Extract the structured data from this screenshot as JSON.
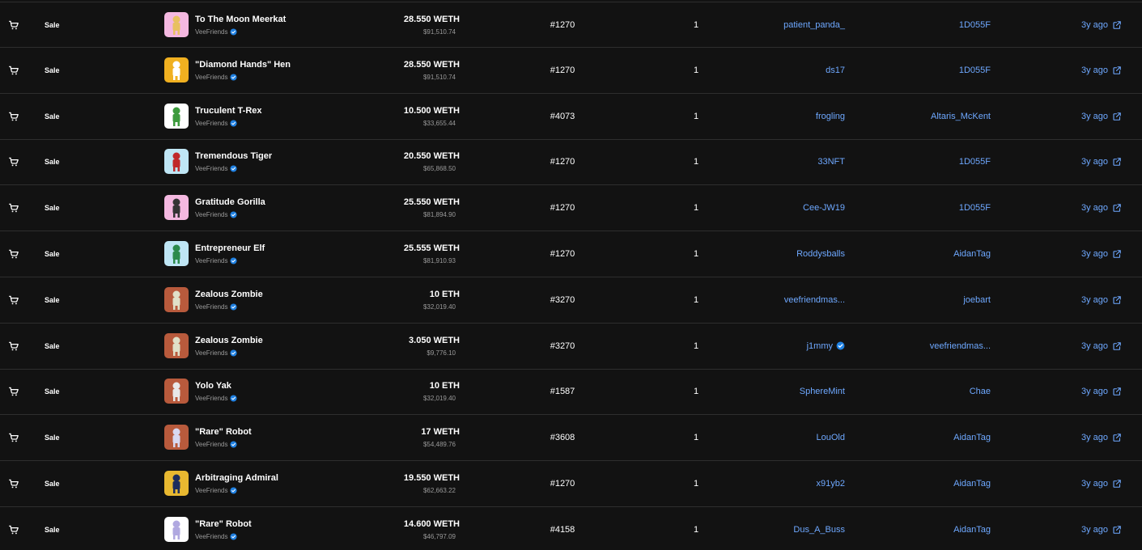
{
  "table": {
    "rows": [
      {
        "event": "Sale",
        "item": "To The Moon Meerkat",
        "collection": "VeeFriends",
        "price": "28.550 WETH",
        "usd": "$91,510.74",
        "rarity": "#1270",
        "quantity": "1",
        "from": "patient_panda_",
        "to": "1D055F",
        "time": "3y ago",
        "thumb_bg": "#f4b8e0",
        "thumb_figure": "#e8c060"
      },
      {
        "event": "Sale",
        "item": "\"Diamond Hands\" Hen",
        "collection": "VeeFriends",
        "price": "28.550 WETH",
        "usd": "$91,510.74",
        "rarity": "#1270",
        "quantity": "1",
        "from": "ds17",
        "to": "1D055F",
        "time": "3y ago",
        "thumb_bg": "#f0b020",
        "thumb_figure": "#ffffff"
      },
      {
        "event": "Sale",
        "item": "Truculent T-Rex",
        "collection": "VeeFriends",
        "price": "10.500 WETH",
        "usd": "$33,655.44",
        "rarity": "#4073",
        "quantity": "1",
        "from": "frogling",
        "to": "Altaris_McKent",
        "time": "3y ago",
        "thumb_bg": "#ffffff",
        "thumb_figure": "#3c9a3c"
      },
      {
        "event": "Sale",
        "item": "Tremendous Tiger",
        "collection": "VeeFriends",
        "price": "20.550 WETH",
        "usd": "$65,868.50",
        "rarity": "#1270",
        "quantity": "1",
        "from": "33NFT",
        "to": "1D055F",
        "time": "3y ago",
        "thumb_bg": "#bfe6f5",
        "thumb_figure": "#c0282a"
      },
      {
        "event": "Sale",
        "item": "Gratitude Gorilla",
        "collection": "VeeFriends",
        "price": "25.550 WETH",
        "usd": "$81,894.90",
        "rarity": "#1270",
        "quantity": "1",
        "from": "Cee-JW19",
        "to": "1D055F",
        "time": "3y ago",
        "thumb_bg": "#f4b8e0",
        "thumb_figure": "#333333"
      },
      {
        "event": "Sale",
        "item": "Entrepreneur Elf",
        "collection": "VeeFriends",
        "price": "25.555 WETH",
        "usd": "$81,910.93",
        "rarity": "#1270",
        "quantity": "1",
        "from": "Roddysballs",
        "to": "AidanTag",
        "time": "3y ago",
        "thumb_bg": "#bfe6f5",
        "thumb_figure": "#2c8a4c"
      },
      {
        "event": "Sale",
        "item": "Zealous Zombie",
        "collection": "VeeFriends",
        "price": "10 ETH",
        "usd": "$32,019.40",
        "rarity": "#3270",
        "quantity": "1",
        "from": "veefriendmas...",
        "to": "joebart",
        "time": "3y ago",
        "thumb_bg": "#b85a3c",
        "thumb_figure": "#e0e0c8"
      },
      {
        "event": "Sale",
        "item": "Zealous Zombie",
        "collection": "VeeFriends",
        "price": "3.050 WETH",
        "usd": "$9,776.10",
        "rarity": "#3270",
        "quantity": "1",
        "from": "j1mmy",
        "from_verified": true,
        "to": "veefriendmas...",
        "time": "3y ago",
        "thumb_bg": "#b85a3c",
        "thumb_figure": "#e0e0c8"
      },
      {
        "event": "Sale",
        "item": "Yolo Yak",
        "collection": "VeeFriends",
        "price": "10 ETH",
        "usd": "$32,019.40",
        "rarity": "#1587",
        "quantity": "1",
        "from": "SphereMint",
        "to": "Chae",
        "time": "3y ago",
        "thumb_bg": "#b85a3c",
        "thumb_figure": "#e8e8e8"
      },
      {
        "event": "Sale",
        "item": "\"Rare\" Robot",
        "collection": "VeeFriends",
        "price": "17 WETH",
        "usd": "$54,489.76",
        "rarity": "#3608",
        "quantity": "1",
        "from": "LouOld",
        "to": "AidanTag",
        "time": "3y ago",
        "thumb_bg": "#b85a3c",
        "thumb_figure": "#d8d8f0"
      },
      {
        "event": "Sale",
        "item": "Arbitraging Admiral",
        "collection": "VeeFriends",
        "price": "19.550 WETH",
        "usd": "$62,663.22",
        "rarity": "#1270",
        "quantity": "1",
        "from": "x91yb2",
        "to": "AidanTag",
        "time": "3y ago",
        "thumb_bg": "#e8b830",
        "thumb_figure": "#1c2c5c"
      },
      {
        "event": "Sale",
        "item": "\"Rare\" Robot",
        "collection": "VeeFriends",
        "price": "14.600 WETH",
        "usd": "$46,797.09",
        "rarity": "#4158",
        "quantity": "1",
        "from": "Dus_A_Buss",
        "to": "AidanTag",
        "time": "3y ago",
        "thumb_bg": "#ffffff",
        "thumb_figure": "#b0a8e0"
      }
    ]
  },
  "icons": {
    "event": "cart-icon",
    "verified": "verified-badge-icon",
    "external_link": "external-link-icon"
  },
  "colors": {
    "background": "#121212",
    "link": "#6ea8ff",
    "verified": "#2081e2",
    "muted": "#9a9a9a"
  }
}
